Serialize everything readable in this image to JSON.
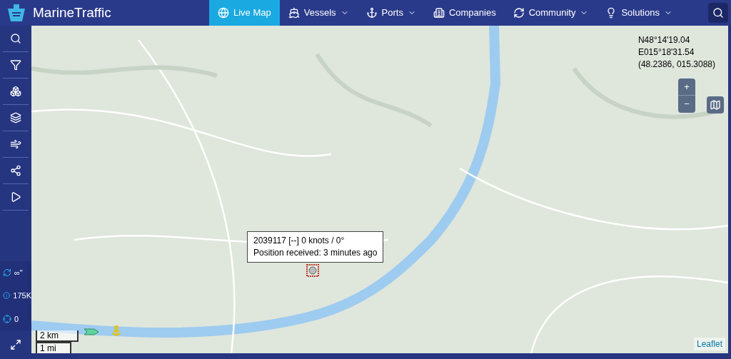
{
  "brand": {
    "name": "MarineTraffic"
  },
  "nav": [
    {
      "label": "Live Map",
      "kind": "globe",
      "selected": true,
      "dropdown": false
    },
    {
      "label": "Vessels",
      "kind": "ship",
      "selected": false,
      "dropdown": true
    },
    {
      "label": "Ports",
      "kind": "anchor",
      "selected": false,
      "dropdown": true
    },
    {
      "label": "Companies",
      "kind": "building",
      "selected": false,
      "dropdown": false
    },
    {
      "label": "Community",
      "kind": "refresh",
      "selected": false,
      "dropdown": true
    },
    {
      "label": "Solutions",
      "kind": "bulb",
      "selected": false,
      "dropdown": true
    }
  ],
  "sidebar": {
    "stats": [
      {
        "kind": "refresh",
        "value": "∞\""
      },
      {
        "kind": "info",
        "value": "175K"
      },
      {
        "kind": "target",
        "value": "0"
      }
    ]
  },
  "map": {
    "coordinates": [
      "N48°14'19.04",
      "E015°18'31.54",
      "(48.2386, 015.3088)"
    ],
    "zoom": {
      "in": "+",
      "out": "−"
    },
    "tooltip": [
      "2039117 [--] 0 knots / 0°",
      "Position received: 3 minutes ago"
    ],
    "scale": [
      "2 km",
      "1 mi"
    ],
    "attribution": "Leaflet"
  }
}
